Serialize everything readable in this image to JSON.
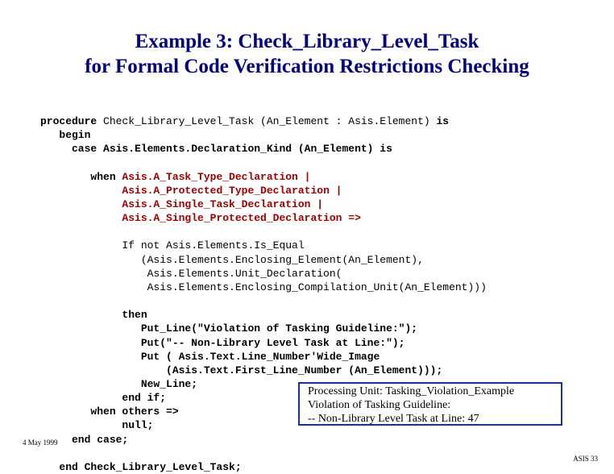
{
  "title_line1": "Example 3: Check_Library_Level_Task",
  "title_line2": "for Formal Code Verification Restrictions Checking",
  "code": {
    "l01a": "procedure",
    "l01b": " Check_Library_Level_Task (An_Element : Asis.Element) ",
    "l01c": "is",
    "l02": "   begin",
    "l03": "     case Asis.Elements.Declaration_Kind (An_Element) is",
    "blank1": "",
    "l04": "        when ",
    "l04a": "Asis.A_Task_Type_Declaration |",
    "l05": "             ",
    "l05a": "Asis.A_Protected_Type_Declaration |",
    "l06": "             ",
    "l06a": "Asis.A_Single_Task_Declaration |",
    "l07": "             ",
    "l07a": "Asis.A_Single_Protected_Declaration =>",
    "blank2": "",
    "l08": "             If not Asis.Elements.Is_Equal",
    "l09": "                (Asis.Elements.Enclosing_Element(An_Element),",
    "l10": "                 Asis.Elements.Unit_Declaration(",
    "l11": "                 Asis.Elements.Enclosing_Compilation_Unit(An_Element)))",
    "blank3": "",
    "l12": "             then",
    "l13": "                Put_Line(\"Violation of Tasking Guideline:\");",
    "l14": "                Put(\"-- Non-Library Level Task at Line:\");",
    "l15": "                Put ( Asis.Text.Line_Number'Wide_Image",
    "l16": "                    (Asis.Text.First_Line_Number (An_Element)));",
    "l17": "                New_Line;",
    "l18": "             end if;",
    "l19": "        when others =>",
    "l20": "             null;",
    "l21": "     end case;",
    "blank4": "",
    "l22": "   end Check_Library_Level_Task;"
  },
  "callout": {
    "line1": "Processing Unit: Tasking_Violation_Example",
    "line2": "Violation of Tasking Guideline:",
    "line3": "-- Non-Library Level Task at Line: 47"
  },
  "footer": {
    "left": "4 May 1999",
    "right": "ASIS 33"
  }
}
